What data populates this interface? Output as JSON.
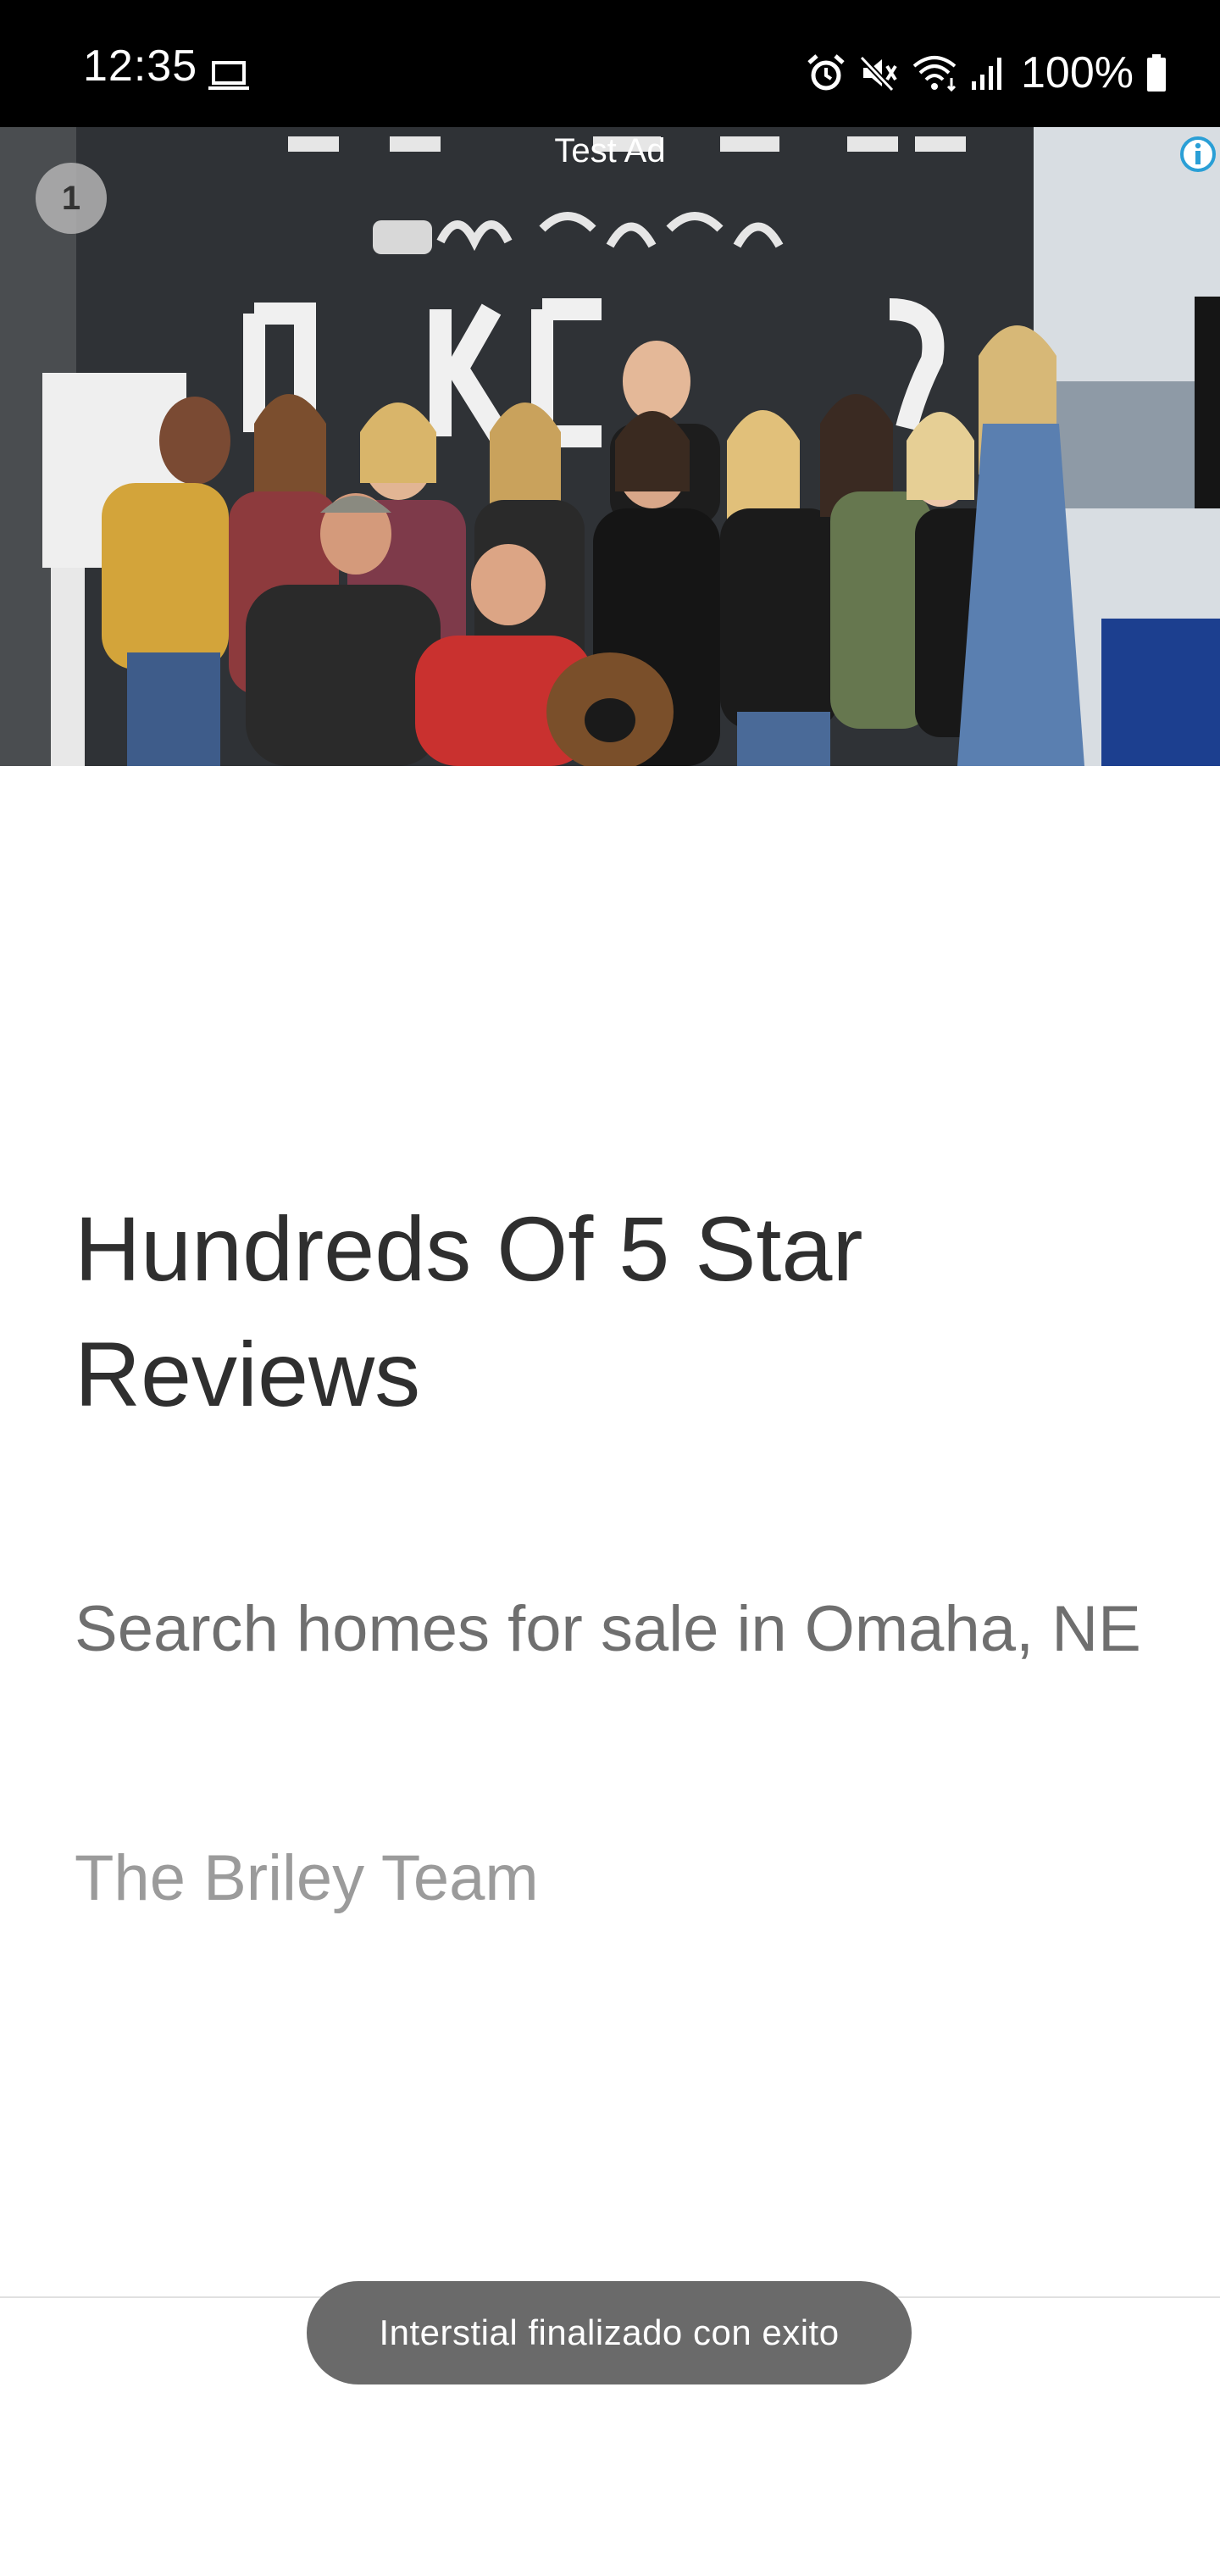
{
  "status_bar": {
    "time": "12:35",
    "battery": "100%",
    "icons": [
      "laptop-icon",
      "alarm-icon",
      "mute-icon",
      "wifi-icon",
      "signal-icon",
      "battery-icon"
    ]
  },
  "ad": {
    "label": "Test Ad",
    "counter": "1",
    "info_icon": "info-icon",
    "headline": "Hundreds Of 5 Star Reviews",
    "body": "Search homes for sale in Omaha, NE",
    "advertiser": "The Briley Team"
  },
  "toast": {
    "message": "Interstial finalizado con exito"
  },
  "colors": {
    "status_bar": "#000000",
    "toast_bg": "#6a6a6a",
    "info_blue": "#2a9fd6"
  }
}
